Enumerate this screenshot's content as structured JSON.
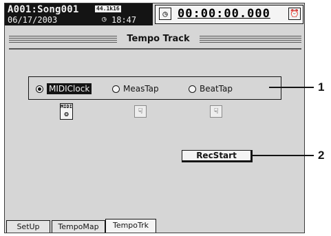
{
  "header": {
    "song_name": "A001:Song001",
    "date": "06/17/2003",
    "sample_rate_badge": "44.1k16",
    "clock_icon_glyph": "◷",
    "clock_time": "18:47",
    "locate_icon_glyph": "◷",
    "locate_time": "00:00:00.000",
    "timer_icon_glyph": "⏰"
  },
  "page": {
    "title": "Tempo Track"
  },
  "source": {
    "options": [
      {
        "label": "MIDIClock",
        "selected": true
      },
      {
        "label": "MeasTap",
        "selected": false
      },
      {
        "label": "BeatTap",
        "selected": false
      }
    ],
    "icons": [
      {
        "name": "midi-icon",
        "caption": "MIDI",
        "glyph": "❂"
      },
      {
        "name": "meas-tap-icon",
        "glyph": "☟"
      },
      {
        "name": "beat-tap-icon",
        "glyph": "☟"
      }
    ]
  },
  "recstart_label": "RecStart",
  "tabs": [
    {
      "label": "SetUp",
      "active": false
    },
    {
      "label": "TempoMap",
      "active": false
    },
    {
      "label": "TempoTrk",
      "active": true
    }
  ],
  "callouts": [
    "1",
    "2"
  ],
  "colors": {
    "lcd_background": "#d6d6d6",
    "ink": "#141414",
    "panel": "#f4f4f4"
  }
}
